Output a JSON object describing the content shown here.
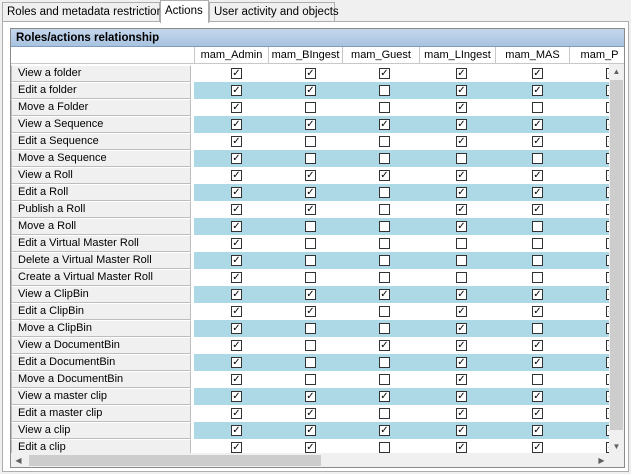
{
  "tabs": [
    {
      "label": "Roles and metadata restrictions",
      "active": false
    },
    {
      "label": "Actions",
      "active": true
    },
    {
      "label": "User activity and objects",
      "active": false
    }
  ],
  "grid": {
    "caption": "Roles/actions relationship",
    "columns": [
      "mam_Admin",
      "mam_BIngest",
      "mam_Guest",
      "mam_LIngest",
      "mam_MAS",
      "mam_P"
    ],
    "rows": [
      {
        "label": "View a folder",
        "checks": [
          1,
          1,
          1,
          1,
          1,
          1
        ]
      },
      {
        "label": "Edit a folder",
        "checks": [
          1,
          1,
          0,
          1,
          1,
          1
        ]
      },
      {
        "label": "Move a Folder",
        "checks": [
          1,
          0,
          0,
          1,
          0,
          0
        ]
      },
      {
        "label": "View a Sequence",
        "checks": [
          1,
          1,
          1,
          1,
          1,
          1
        ]
      },
      {
        "label": "Edit a Sequence",
        "checks": [
          1,
          0,
          0,
          1,
          1,
          1
        ]
      },
      {
        "label": "Move a Sequence",
        "checks": [
          1,
          0,
          0,
          0,
          0,
          0
        ]
      },
      {
        "label": "View a Roll",
        "checks": [
          1,
          1,
          1,
          1,
          1,
          1
        ]
      },
      {
        "label": "Edit a Roll",
        "checks": [
          1,
          1,
          0,
          1,
          1,
          1
        ]
      },
      {
        "label": "Publish a Roll",
        "checks": [
          1,
          1,
          0,
          1,
          1,
          1
        ]
      },
      {
        "label": "Move a Roll",
        "checks": [
          1,
          0,
          0,
          1,
          0,
          1
        ]
      },
      {
        "label": "Edit a Virtual Master Roll",
        "checks": [
          1,
          0,
          0,
          0,
          0,
          0
        ]
      },
      {
        "label": "Delete a Virtual Master Roll",
        "checks": [
          1,
          0,
          0,
          0,
          0,
          0
        ]
      },
      {
        "label": "Create a Virtual Master Roll",
        "checks": [
          1,
          0,
          0,
          0,
          0,
          0
        ]
      },
      {
        "label": "View a ClipBin",
        "checks": [
          1,
          1,
          1,
          1,
          1,
          1
        ]
      },
      {
        "label": "Edit a ClipBin",
        "checks": [
          1,
          1,
          0,
          1,
          1,
          1
        ]
      },
      {
        "label": "Move a ClipBin",
        "checks": [
          1,
          0,
          0,
          1,
          0,
          0
        ]
      },
      {
        "label": "View a DocumentBin",
        "checks": [
          1,
          0,
          1,
          1,
          1,
          1
        ]
      },
      {
        "label": "Edit a DocumentBin",
        "checks": [
          1,
          0,
          0,
          1,
          1,
          1
        ]
      },
      {
        "label": "Move a DocumentBin",
        "checks": [
          1,
          0,
          0,
          1,
          0,
          0
        ]
      },
      {
        "label": "View a master clip",
        "checks": [
          1,
          1,
          1,
          1,
          1,
          1
        ]
      },
      {
        "label": "Edit a master clip",
        "checks": [
          1,
          1,
          0,
          1,
          1,
          1
        ]
      },
      {
        "label": "View a clip",
        "checks": [
          1,
          1,
          1,
          1,
          1,
          1
        ]
      },
      {
        "label": "Edit a clip",
        "checks": [
          1,
          1,
          0,
          1,
          1,
          1
        ]
      }
    ]
  },
  "scroll": {
    "vertical_up_icon": "arrow-up-icon",
    "vertical_down_icon": "arrow-down-icon",
    "horizontal_left_icon": "arrow-left-icon",
    "horizontal_right_icon": "arrow-right-icon"
  },
  "colors": {
    "alt_row": "#add8e6",
    "caption_bg": "#b8cfe8"
  }
}
